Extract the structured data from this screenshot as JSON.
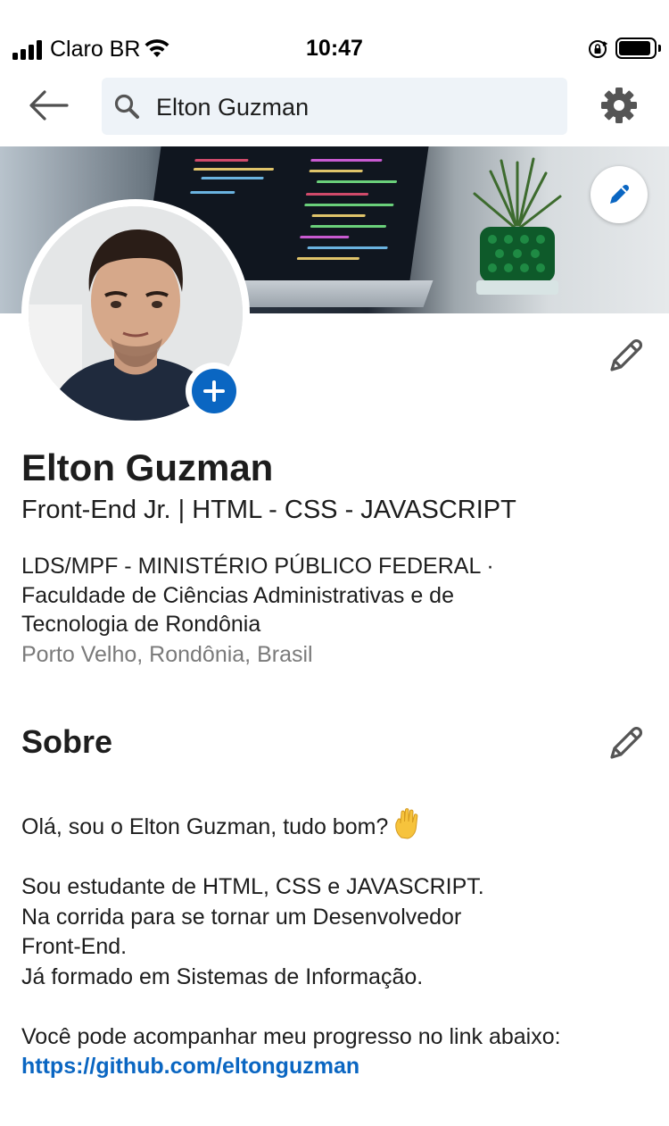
{
  "status_bar": {
    "carrier": "Claro BR",
    "time": "10:47",
    "icons": [
      "signal-icon",
      "wifi-icon",
      "orientation-lock-icon",
      "battery-icon"
    ]
  },
  "header": {
    "back_icon": "arrow-left-icon",
    "search_icon": "search-icon",
    "search_value": "Elton Guzman",
    "settings_icon": "gear-icon"
  },
  "profile": {
    "name": "Elton Guzman",
    "headline": "Front-End Jr. | HTML - CSS - JAVASCRIPT",
    "org_line_1": "LDS/MPF - MINISTÉRIO PÚBLICO FEDERAL ·",
    "org_line_2": "Faculdade de Ciências Administrativas e de",
    "org_line_3": "Tecnologia de Rondônia",
    "location": "Porto Velho, Rondônia, Brasil"
  },
  "about": {
    "title": "Sobre",
    "greeting": "Olá, sou o Elton Guzman, tudo bom?",
    "greeting_emoji": "raised-hand-icon",
    "line_1": "Sou estudante de HTML, CSS e JAVASCRIPT.",
    "line_2": "Na corrida para se tornar um Desenvolvedor",
    "line_3": "Front-End.",
    "line_4": "Já formado em Sistemas de Informação.",
    "line_5": "Você pode acompanhar meu progresso no link abaixo:",
    "link": "https://github.com/eltonguzman"
  },
  "colors": {
    "accent": "#0a66c2",
    "search_bg": "#eef3f8",
    "text": "#1d1d1d",
    "muted": "#7a7a7a"
  }
}
